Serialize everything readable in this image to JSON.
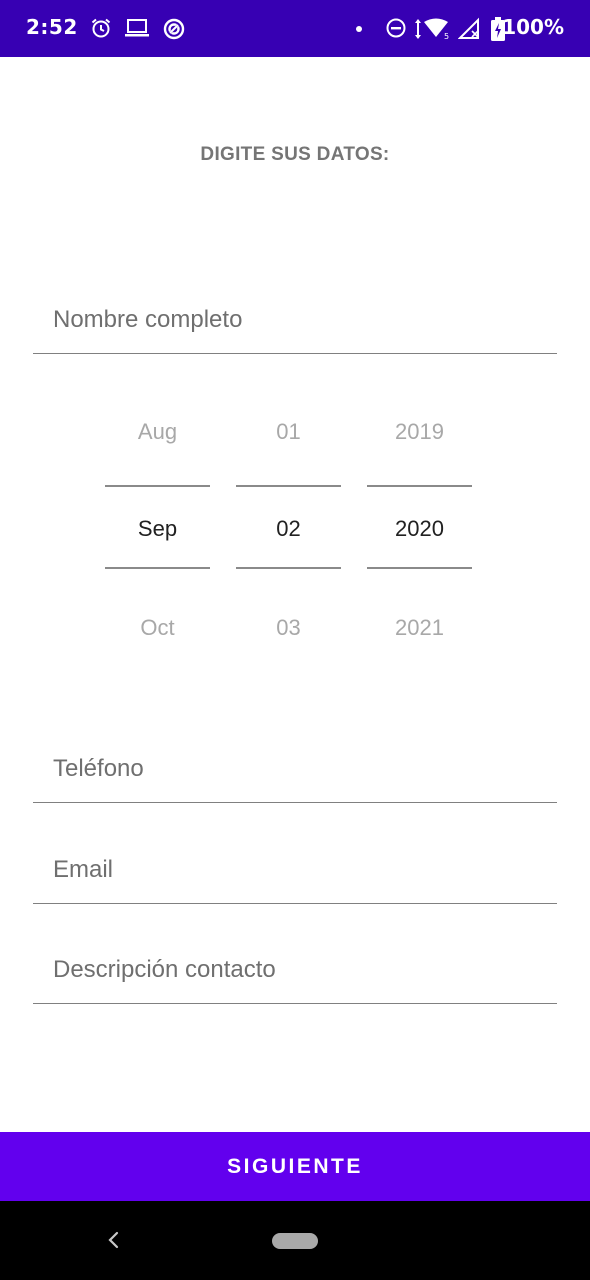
{
  "status_bar": {
    "time": "2:52",
    "battery": "100%",
    "icons": [
      "alarm-icon",
      "laptop-icon",
      "data-saver-icon",
      "dot-icon",
      "do-not-disturb-icon",
      "wifi-icon",
      "signal-icon",
      "battery-charging-icon"
    ],
    "background": "#3700b3"
  },
  "form": {
    "title": "DIGITE SUS DATOS:",
    "name_placeholder": "Nombre completo",
    "phone_placeholder": "Teléfono",
    "email_placeholder": "Email",
    "description_placeholder": "Descripción contacto"
  },
  "date_picker": {
    "month": {
      "prev": "Aug",
      "current": "Sep",
      "next": "Oct"
    },
    "day": {
      "prev": "01",
      "current": "02",
      "next": "03"
    },
    "year": {
      "prev": "2019",
      "current": "2020",
      "next": "2021"
    }
  },
  "next_button": {
    "label": "SIGUIENTE",
    "color": "#6200ee"
  },
  "nav_bar": {
    "icons": [
      "back-icon",
      "home-pill-icon"
    ]
  }
}
